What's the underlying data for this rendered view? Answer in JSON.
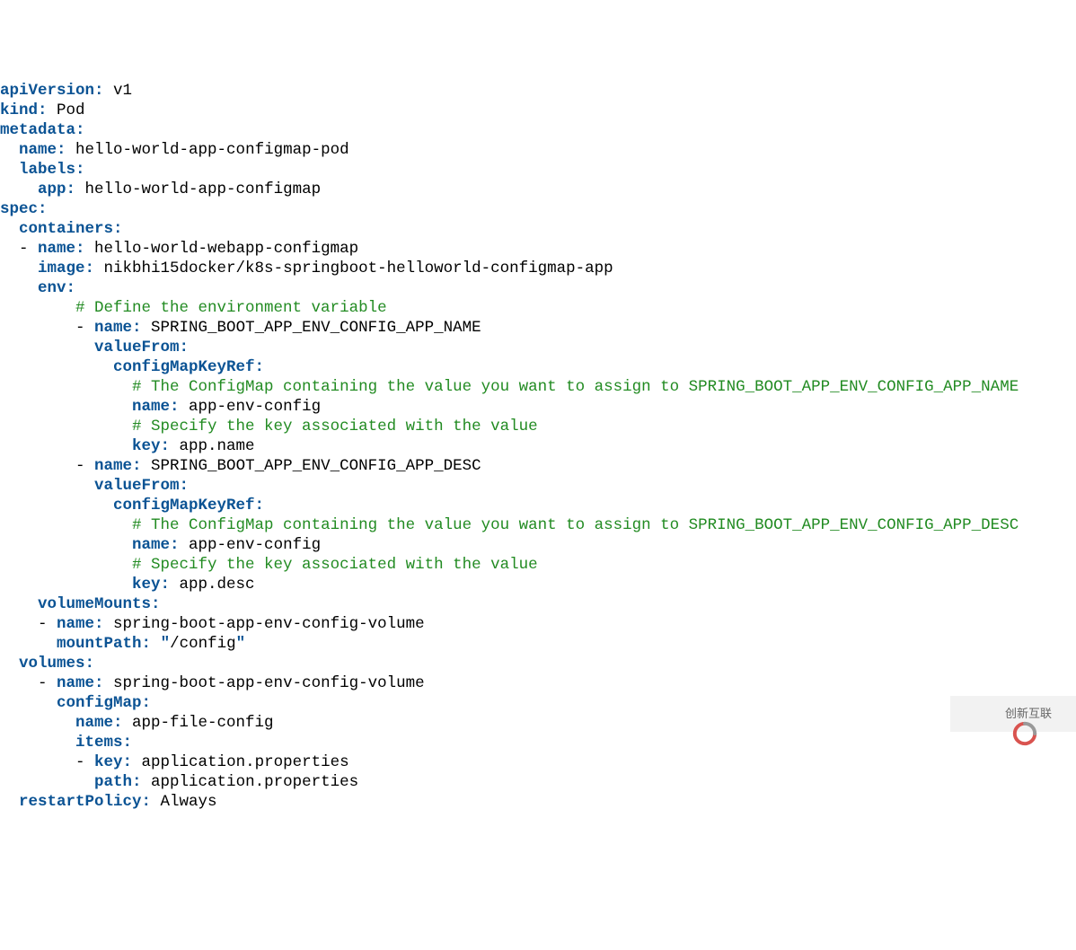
{
  "lines": [
    [
      {
        "t": "apiVersion:",
        "c": "k"
      },
      {
        "t": " v1",
        "c": "v"
      }
    ],
    [
      {
        "t": "kind:",
        "c": "k"
      },
      {
        "t": " Pod",
        "c": "v"
      }
    ],
    [
      {
        "t": "metadata:",
        "c": "k"
      }
    ],
    [
      {
        "t": "  ",
        "c": "v"
      },
      {
        "t": "name:",
        "c": "k"
      },
      {
        "t": " hello-world-app-configmap-pod",
        "c": "v"
      }
    ],
    [
      {
        "t": "  ",
        "c": "v"
      },
      {
        "t": "labels:",
        "c": "k"
      }
    ],
    [
      {
        "t": "    ",
        "c": "v"
      },
      {
        "t": "app:",
        "c": "k"
      },
      {
        "t": " hello-world-app-configmap",
        "c": "v"
      }
    ],
    [
      {
        "t": "spec:",
        "c": "k"
      }
    ],
    [
      {
        "t": "  ",
        "c": "v"
      },
      {
        "t": "containers:",
        "c": "k"
      }
    ],
    [
      {
        "t": "  - ",
        "c": "v"
      },
      {
        "t": "name:",
        "c": "k"
      },
      {
        "t": " hello-world-webapp-configmap",
        "c": "v"
      }
    ],
    [
      {
        "t": "    ",
        "c": "v"
      },
      {
        "t": "image:",
        "c": "k"
      },
      {
        "t": " nikbhi15docker/k8s-springboot-helloworld-configmap-app",
        "c": "v"
      }
    ],
    [
      {
        "t": "    ",
        "c": "v"
      },
      {
        "t": "env:",
        "c": "k"
      }
    ],
    [
      {
        "t": "        ",
        "c": "v"
      },
      {
        "t": "# Define the environment variable",
        "c": "c"
      }
    ],
    [
      {
        "t": "        - ",
        "c": "v"
      },
      {
        "t": "name:",
        "c": "k"
      },
      {
        "t": " SPRING_BOOT_APP_ENV_CONFIG_APP_NAME",
        "c": "v"
      }
    ],
    [
      {
        "t": "          ",
        "c": "v"
      },
      {
        "t": "valueFrom:",
        "c": "k"
      }
    ],
    [
      {
        "t": "            ",
        "c": "v"
      },
      {
        "t": "configMapKeyRef:",
        "c": "k"
      }
    ],
    [
      {
        "t": "              ",
        "c": "v"
      },
      {
        "t": "# The ConfigMap containing the value you want to assign to SPRING_BOOT_APP_ENV_CONFIG_APP_NAME",
        "c": "c"
      }
    ],
    [
      {
        "t": "              ",
        "c": "v"
      },
      {
        "t": "name:",
        "c": "k"
      },
      {
        "t": " app-env-config",
        "c": "v"
      }
    ],
    [
      {
        "t": "              ",
        "c": "v"
      },
      {
        "t": "# Specify the key associated with the value",
        "c": "c"
      }
    ],
    [
      {
        "t": "              ",
        "c": "v"
      },
      {
        "t": "key:",
        "c": "k"
      },
      {
        "t": " app.name",
        "c": "v"
      }
    ],
    [
      {
        "t": "        - ",
        "c": "v"
      },
      {
        "t": "name:",
        "c": "k"
      },
      {
        "t": " SPRING_BOOT_APP_ENV_CONFIG_APP_DESC",
        "c": "v"
      }
    ],
    [
      {
        "t": "          ",
        "c": "v"
      },
      {
        "t": "valueFrom:",
        "c": "k"
      }
    ],
    [
      {
        "t": "            ",
        "c": "v"
      },
      {
        "t": "configMapKeyRef:",
        "c": "k"
      }
    ],
    [
      {
        "t": "              ",
        "c": "v"
      },
      {
        "t": "# The ConfigMap containing the value you want to assign to SPRING_BOOT_APP_ENV_CONFIG_APP_DESC",
        "c": "c"
      }
    ],
    [
      {
        "t": "              ",
        "c": "v"
      },
      {
        "t": "name:",
        "c": "k"
      },
      {
        "t": " app-env-config",
        "c": "v"
      }
    ],
    [
      {
        "t": "              ",
        "c": "v"
      },
      {
        "t": "# Specify the key associated with the value",
        "c": "c"
      }
    ],
    [
      {
        "t": "              ",
        "c": "v"
      },
      {
        "t": "key:",
        "c": "k"
      },
      {
        "t": " app.desc",
        "c": "v"
      }
    ],
    [
      {
        "t": "    ",
        "c": "v"
      },
      {
        "t": "volumeMounts:",
        "c": "k"
      }
    ],
    [
      {
        "t": "    - ",
        "c": "v"
      },
      {
        "t": "name:",
        "c": "k"
      },
      {
        "t": " spring-boot-app-env-config-volume",
        "c": "v"
      }
    ],
    [
      {
        "t": "      ",
        "c": "v"
      },
      {
        "t": "mountPath:",
        "c": "k"
      },
      {
        "t": " ",
        "c": "v"
      },
      {
        "t": "\"",
        "c": "k"
      },
      {
        "t": "/config",
        "c": "v"
      },
      {
        "t": "\"",
        "c": "k"
      }
    ],
    [
      {
        "t": "  ",
        "c": "v"
      },
      {
        "t": "volumes:",
        "c": "k"
      }
    ],
    [
      {
        "t": "    - ",
        "c": "v"
      },
      {
        "t": "name:",
        "c": "k"
      },
      {
        "t": " spring-boot-app-env-config-volume",
        "c": "v"
      }
    ],
    [
      {
        "t": "      ",
        "c": "v"
      },
      {
        "t": "configMap:",
        "c": "k"
      }
    ],
    [
      {
        "t": "        ",
        "c": "v"
      },
      {
        "t": "name:",
        "c": "k"
      },
      {
        "t": " app-file-config",
        "c": "v"
      }
    ],
    [
      {
        "t": "        ",
        "c": "v"
      },
      {
        "t": "items:",
        "c": "k"
      }
    ],
    [
      {
        "t": "        - ",
        "c": "v"
      },
      {
        "t": "key:",
        "c": "k"
      },
      {
        "t": " application.properties",
        "c": "v"
      }
    ],
    [
      {
        "t": "          ",
        "c": "v"
      },
      {
        "t": "path:",
        "c": "k"
      },
      {
        "t": " application.properties",
        "c": "v"
      }
    ],
    [
      {
        "t": "  ",
        "c": "v"
      },
      {
        "t": "restartPolicy:",
        "c": "k"
      },
      {
        "t": " Always",
        "c": "v"
      }
    ]
  ],
  "watermark": {
    "text": "创新互联"
  }
}
